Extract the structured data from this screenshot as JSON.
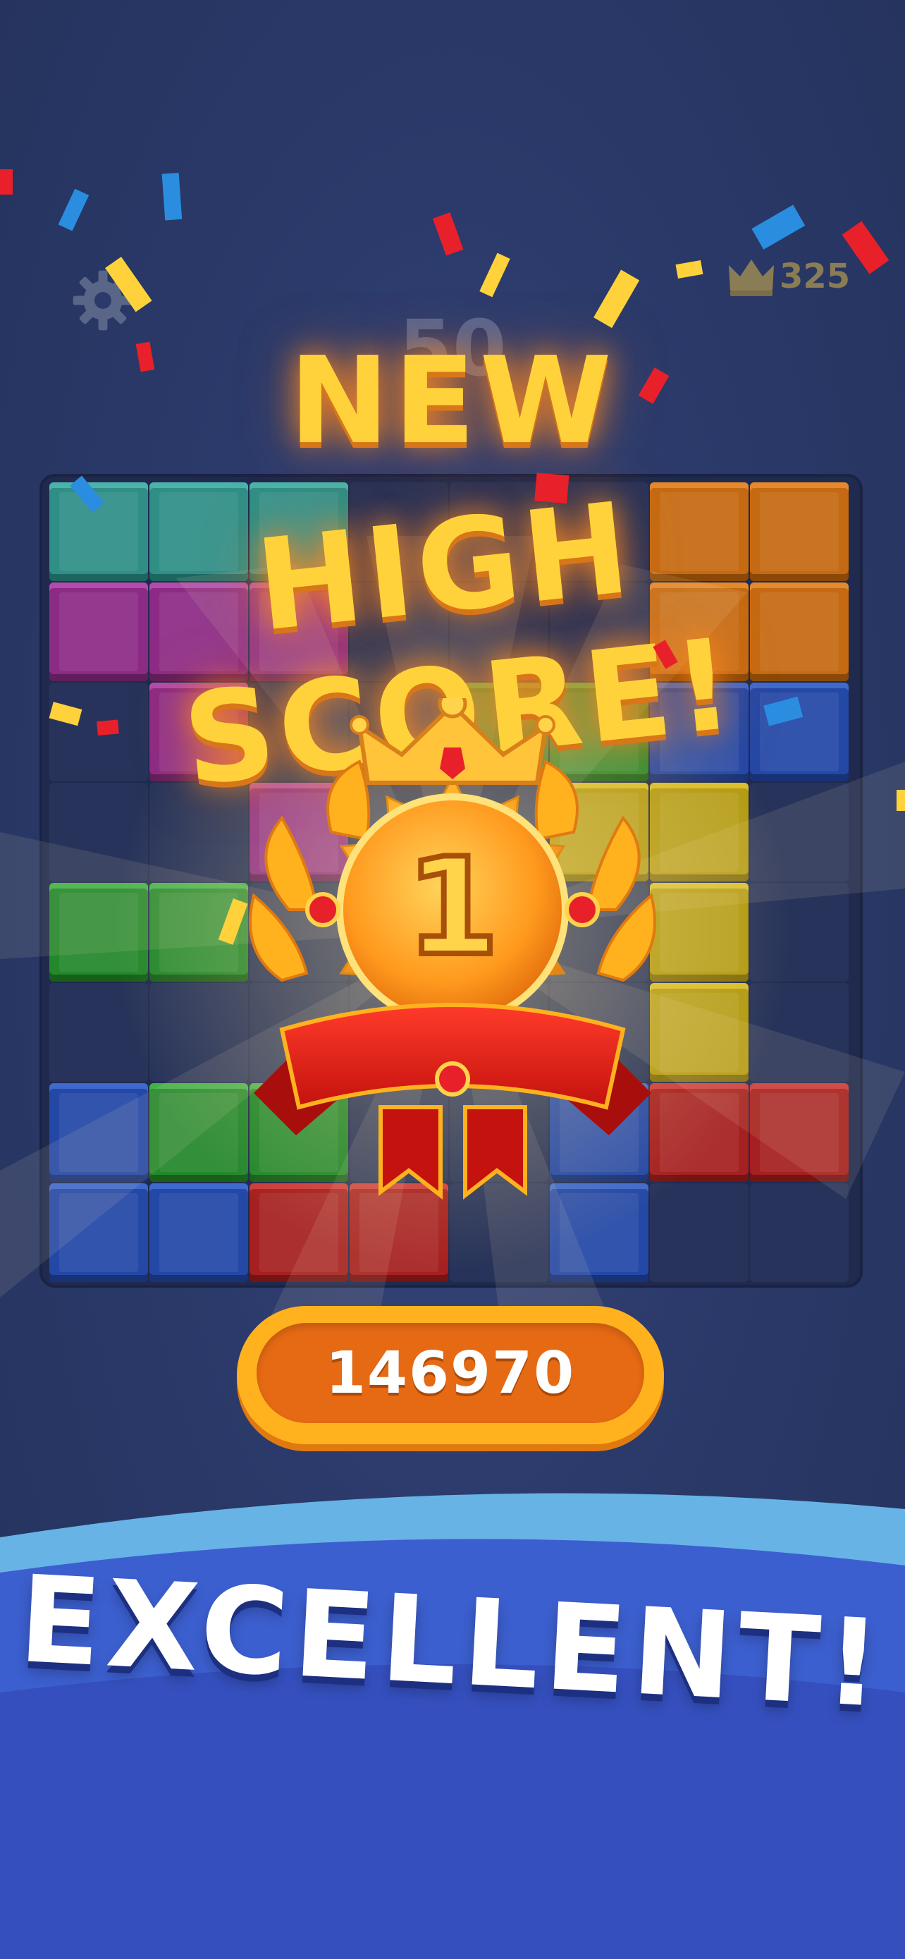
{
  "header": {
    "best_score": "325",
    "ghost_score": "50"
  },
  "overlay": {
    "title_line1": "NEW",
    "title_line2": "HIGH SCORE!",
    "rank": "1",
    "score": "146970",
    "praise": "EXCELLENT!"
  },
  "icons": {
    "settings": "gear-icon",
    "best": "crown-icon",
    "medal": "trophy-medal-icon"
  },
  "colors": {
    "background": "#2b3a6a",
    "board": "#1f2a4e",
    "headline": "#ffd23c",
    "headline_glow": "#ff8c1e",
    "score_pill_outer": "#ffb21e",
    "score_pill_inner": "#e66a14",
    "banner_light": "#67b3e6",
    "banner_dark": "#3a4fc2"
  },
  "board": {
    "size": "8x8",
    "rows": [
      [
        "teal",
        "teal",
        "teal",
        "empty",
        "empty",
        "empty",
        "orange",
        "orange"
      ],
      [
        "purple",
        "purple",
        "purple",
        "empty",
        "empty",
        "empty",
        "orange",
        "orange"
      ],
      [
        "empty",
        "purple",
        "empty",
        "empty",
        "green",
        "green",
        "blue",
        "blue"
      ],
      [
        "empty",
        "empty",
        "purple",
        "empty",
        "empty",
        "yellow",
        "yellow",
        "empty"
      ],
      [
        "green",
        "green",
        "empty",
        "empty",
        "empty",
        "empty",
        "yellow",
        "empty"
      ],
      [
        "empty",
        "empty",
        "empty",
        "empty",
        "empty",
        "empty",
        "yellow",
        "empty"
      ],
      [
        "blue",
        "green",
        "green",
        "empty",
        "empty",
        "blue",
        "red",
        "red"
      ],
      [
        "blue",
        "blue",
        "red",
        "red",
        "empty",
        "blue",
        "empty",
        "empty"
      ]
    ]
  }
}
